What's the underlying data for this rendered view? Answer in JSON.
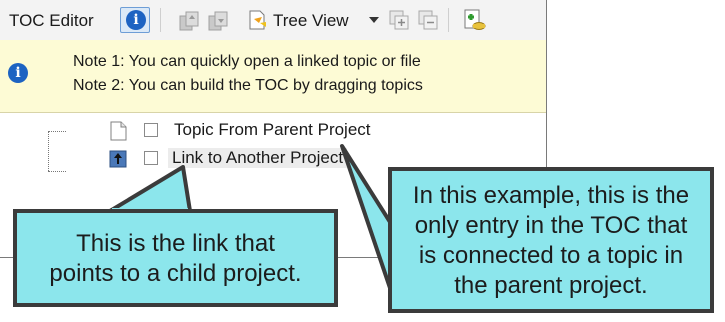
{
  "toolbar": {
    "title": "TOC Editor",
    "info_glyph": "i",
    "tree_view_label": "Tree View",
    "icons": [
      "info-icon",
      "move-up-icon",
      "move-down-icon",
      "tree-view-icon",
      "expand-all-icon",
      "collapse-all-icon",
      "bind-icon"
    ]
  },
  "notes": {
    "info_glyph": "i",
    "note1": "Note 1: You can quickly open a linked topic or file",
    "note2": "Note 2: You can build the TOC by dragging topics"
  },
  "tree": {
    "items": [
      {
        "label": "Topic From Parent Project",
        "icon": "document-icon"
      },
      {
        "label": "Link to Another Project",
        "icon": "project-link-icon"
      }
    ]
  },
  "callouts": {
    "left_line1": "This is the link that",
    "left_line2": "points to a child project.",
    "right_line1": "In this example, this is the",
    "right_line2": "only entry in the TOC that",
    "right_line3": "is connected to a topic in",
    "right_line4": "the parent project."
  },
  "colors": {
    "callout_fill": "#8ce6ec",
    "callout_border": "#3b3b3b",
    "notes_bg": "#fdfbd5",
    "info_blue": "#1d63c2"
  }
}
